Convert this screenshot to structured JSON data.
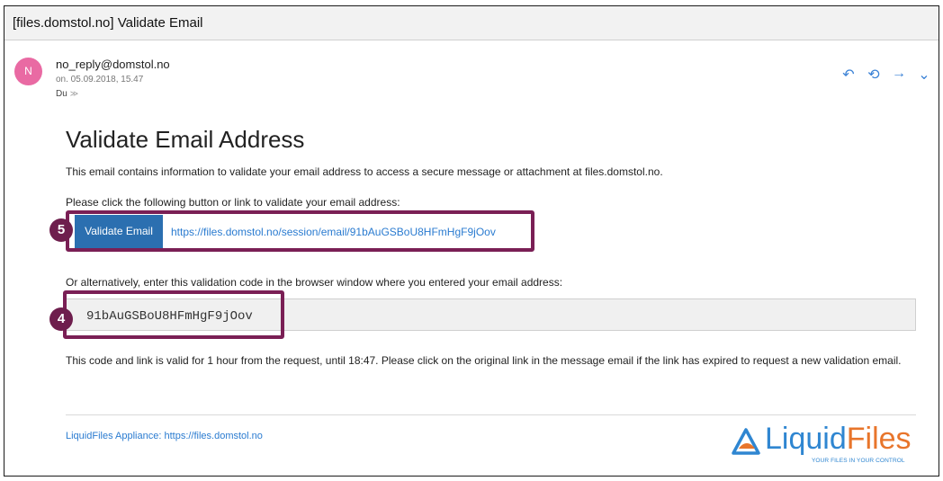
{
  "subject": "[files.domstol.no] Validate Email",
  "sender": {
    "avatar_letter": "N",
    "avatar_color": "#e96aa3",
    "address": "no_reply@domstol.no",
    "date": "on. 05.09.2018, 15.47",
    "to_label": "Du",
    "to_chevron": "≫"
  },
  "actions": {
    "reply": "↶",
    "reply_all": "⟲",
    "forward": "→",
    "more": "⌄"
  },
  "body": {
    "title": "Validate Email Address",
    "intro": "This email contains information to validate your email address to access a secure message or attachment at files.domstol.no.",
    "instruction": "Please click the following button or link to validate your email address:",
    "button_label": "Validate Email",
    "link": "https://files.domstol.no/session/email/91bAuGSBoU8HFmHgF9jOov",
    "alternative": "Or alternatively, enter this validation code in the browser window where you entered your email address:",
    "code": "91bAuGSBoU8HFmHgF9jOov",
    "note": "This code and link is valid for 1 hour from the request, until 18:47. Please click on the original link in the message email if the link has expired to request a new validation email."
  },
  "annotations": {
    "badge_button": "5",
    "badge_code": "4",
    "highlight_color": "#7a1f55"
  },
  "footer": {
    "label": "LiquidFiles Appliance:",
    "link": "https://files.domstol.no"
  },
  "logo": {
    "name_part1": "Liquid",
    "name_part2": "Files",
    "tagline": "YOUR FILES IN YOUR CONTROL",
    "brand_blue": "#2f86d1",
    "brand_orange": "#e8752b"
  }
}
